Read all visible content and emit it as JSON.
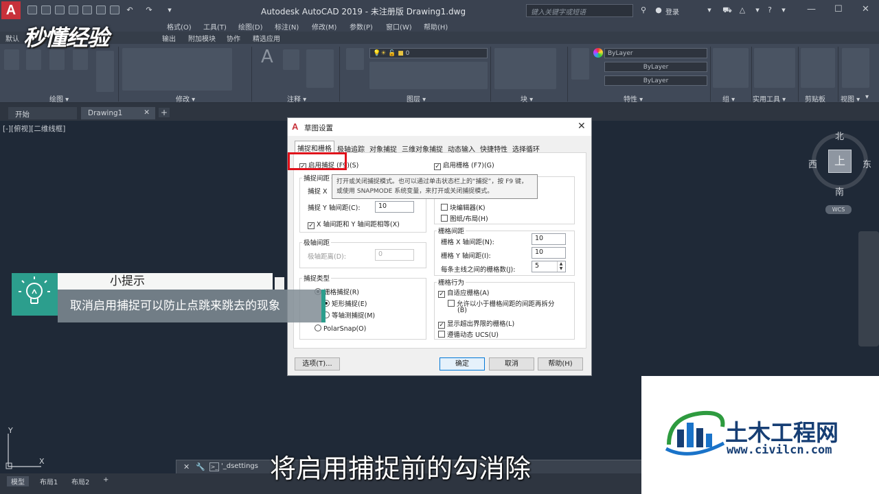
{
  "titlebar": {
    "logo": "A",
    "window_title": "Autodesk AutoCAD 2019 - 未注册版     Drawing1.dwg",
    "search_placeholder": "键入关键字或短语",
    "login": "登录"
  },
  "menubar": {
    "items": [
      "格式(O)",
      "工具(T)",
      "绘图(D)",
      "标注(N)",
      "修改(M)",
      "参数(P)",
      "窗口(W)",
      "帮助(H)"
    ]
  },
  "ribbon_tabs": [
    "默认",
    "输出",
    "附加模块",
    "协作",
    "精选应用"
  ],
  "ribbon": {
    "panels": [
      "绘图 ▾",
      "修改 ▾",
      "注释 ▾",
      "图层 ▾",
      "块 ▾",
      "特性 ▾",
      "组 ▾",
      "实用工具 ▾",
      "剪贴板",
      "视图 ▾"
    ],
    "layer_combo": "0",
    "bylayer_1": "ByLayer",
    "bylayer_2": "ByLayer",
    "bylayer_3": "ByLayer"
  },
  "doc_tabs": [
    "开始",
    "Drawing1"
  ],
  "viewport_label": "[-][俯视][二维线框]",
  "viewcube": {
    "north": "北",
    "south": "南",
    "east": "东",
    "west": "西",
    "top": "上",
    "wcs": "WCS"
  },
  "ucs": {
    "x": "X",
    "y": "Y"
  },
  "dialog": {
    "title": "草图设置",
    "tabs": [
      "捕捉和栅格",
      "极轴追踪",
      "对象捕捉",
      "三维对象捕捉",
      "动态输入",
      "快捷特性",
      "选择循环"
    ],
    "snap_on": {
      "label": "启用捕捉 (F9)(S)",
      "checked": true
    },
    "grid_on": {
      "label": "启用栅格 (F7)(G)",
      "checked": true
    },
    "tooltip": "打开或关闭捕捉模式。也可以通过单击状态栏上的“捕捉”，按 F9 键，或使用 SNAPMODE 系统变量，来打开或关闭捕捉模式。",
    "snap_spacing": {
      "title": "捕捉间距",
      "x_label": "捕捉 X",
      "y_label": "捕捉 Y 轴间距(C):",
      "y_value": "10",
      "equal_label": "X 轴间距和 Y 轴间距相等(X)"
    },
    "polar_spacing": {
      "title": "极轴间距",
      "label": "极轴距离(D):",
      "value": "0"
    },
    "snap_type": {
      "title": "捕捉类型",
      "grid": "栅格捕捉(R)",
      "rect": "矩形捕捉(E)",
      "iso": "等轴测捕捉(M)",
      "polar": "PolarSnap(O)"
    },
    "grid_display": {
      "block": "块编辑器(K)",
      "paper": "图纸/布局(H)"
    },
    "grid_spacing": {
      "title": "栅格间距",
      "x_label": "栅格 X 轴间距(N):",
      "x_value": "10",
      "y_label": "栅格 Y 轴间距(I):",
      "y_value": "10",
      "major_label": "每条主线之间的栅格数(J):",
      "major_value": "5"
    },
    "grid_behavior": {
      "title": "栅格行为",
      "adaptive": "自适应栅格(A)",
      "subdiv_1": "允许以小于栅格间距的间距再拆分",
      "subdiv_2": "(B)",
      "beyond": "显示超出界限的栅格(L)",
      "follow": "遵循动态 UCS(U)"
    },
    "buttons": {
      "options": "选项(T)...",
      "ok": "确定",
      "cancel": "取消",
      "help": "帮助(H)"
    }
  },
  "tip": {
    "header": "小提示",
    "body": "取消启用捕捉可以防止点跳来跳去的现象"
  },
  "command_line": {
    "text": "'_dsettings"
  },
  "layout_tabs": [
    "模型",
    "布局1",
    "布局2"
  ],
  "caption": "将启用捕捉前的勾消除",
  "watermark": "秒懂经验",
  "brand": {
    "name": "土木工程网",
    "url": "www.civilcn.com",
    "color": "#163e74"
  }
}
